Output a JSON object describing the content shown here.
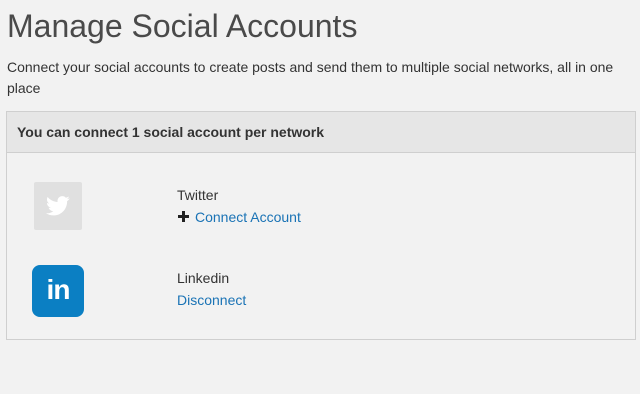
{
  "header": {
    "title": "Manage Social Accounts",
    "subtitle": "Connect your social accounts to create posts and send them to multiple social networks, all in one place"
  },
  "panel": {
    "notice": "You can connect 1 social account per network"
  },
  "networks": [
    {
      "name": "Twitter",
      "icon": "twitter-icon",
      "action_label": "Connect Account",
      "action_icon": "plus-icon",
      "connected": false,
      "logo_color": "#e0e0e0"
    },
    {
      "name": "Linkedin",
      "icon": "linkedin-icon",
      "logo_text": "in",
      "action_label": "Disconnect",
      "connected": true,
      "logo_color": "#0b7fc3"
    }
  ],
  "colors": {
    "link": "#1a73b5",
    "background": "#f2f2f2",
    "panel_header": "#e6e6e6"
  }
}
